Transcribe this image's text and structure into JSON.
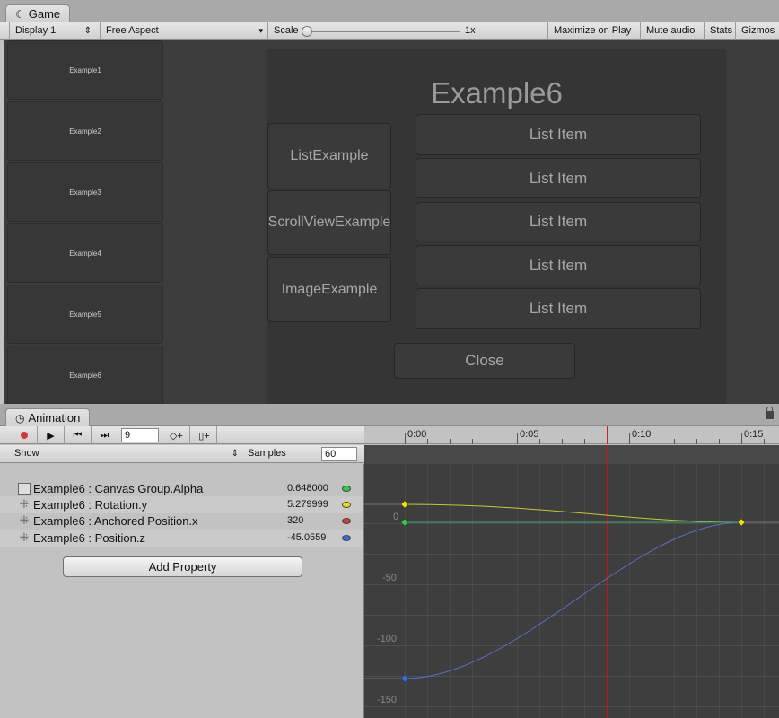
{
  "game_tab": {
    "title": "Game"
  },
  "game_toolbar": {
    "display": "Display 1",
    "aspect": "Free Aspect",
    "scale_label": "Scale",
    "scale_value": "1x",
    "maximize": "Maximize on Play",
    "mute": "Mute audio",
    "stats": "Stats",
    "gizmos": "Gizmos"
  },
  "game_view": {
    "nav_buttons": [
      "Example1",
      "Example2",
      "Example3",
      "Example4",
      "Example5",
      "Example6"
    ],
    "panel_title": "Example6",
    "side_buttons": [
      "ListExample",
      "ScrollViewExample",
      "ImageExample"
    ],
    "list_items": [
      "List Item",
      "List Item",
      "List Item",
      "List Item",
      "List Item"
    ],
    "close": "Close"
  },
  "animation_tab": {
    "title": "Animation"
  },
  "anim_toolbar": {
    "frame": "9"
  },
  "show_row": {
    "show": "Show",
    "samples_label": "Samples",
    "samples": "60"
  },
  "properties": [
    {
      "name": "Example6 : Canvas Group.Alpha",
      "value": "0.648000",
      "color": "#2ecc40"
    },
    {
      "name": "Example6 : Rotation.y",
      "value": "5.279999",
      "color": "#f0e000"
    },
    {
      "name": "Example6 : Anchored Position.x",
      "value": "320",
      "color": "#d63a2a"
    },
    {
      "name": "Example6 : Position.z",
      "value": "-45.0559",
      "color": "#2e6ef0"
    }
  ],
  "add_property": "Add Property",
  "timeline": {
    "ticks": [
      "0:00",
      "0:05",
      "0:10",
      "0:15"
    ]
  },
  "curve_axis": {
    "labels": [
      "0",
      "-50",
      "-100",
      "-150"
    ]
  }
}
